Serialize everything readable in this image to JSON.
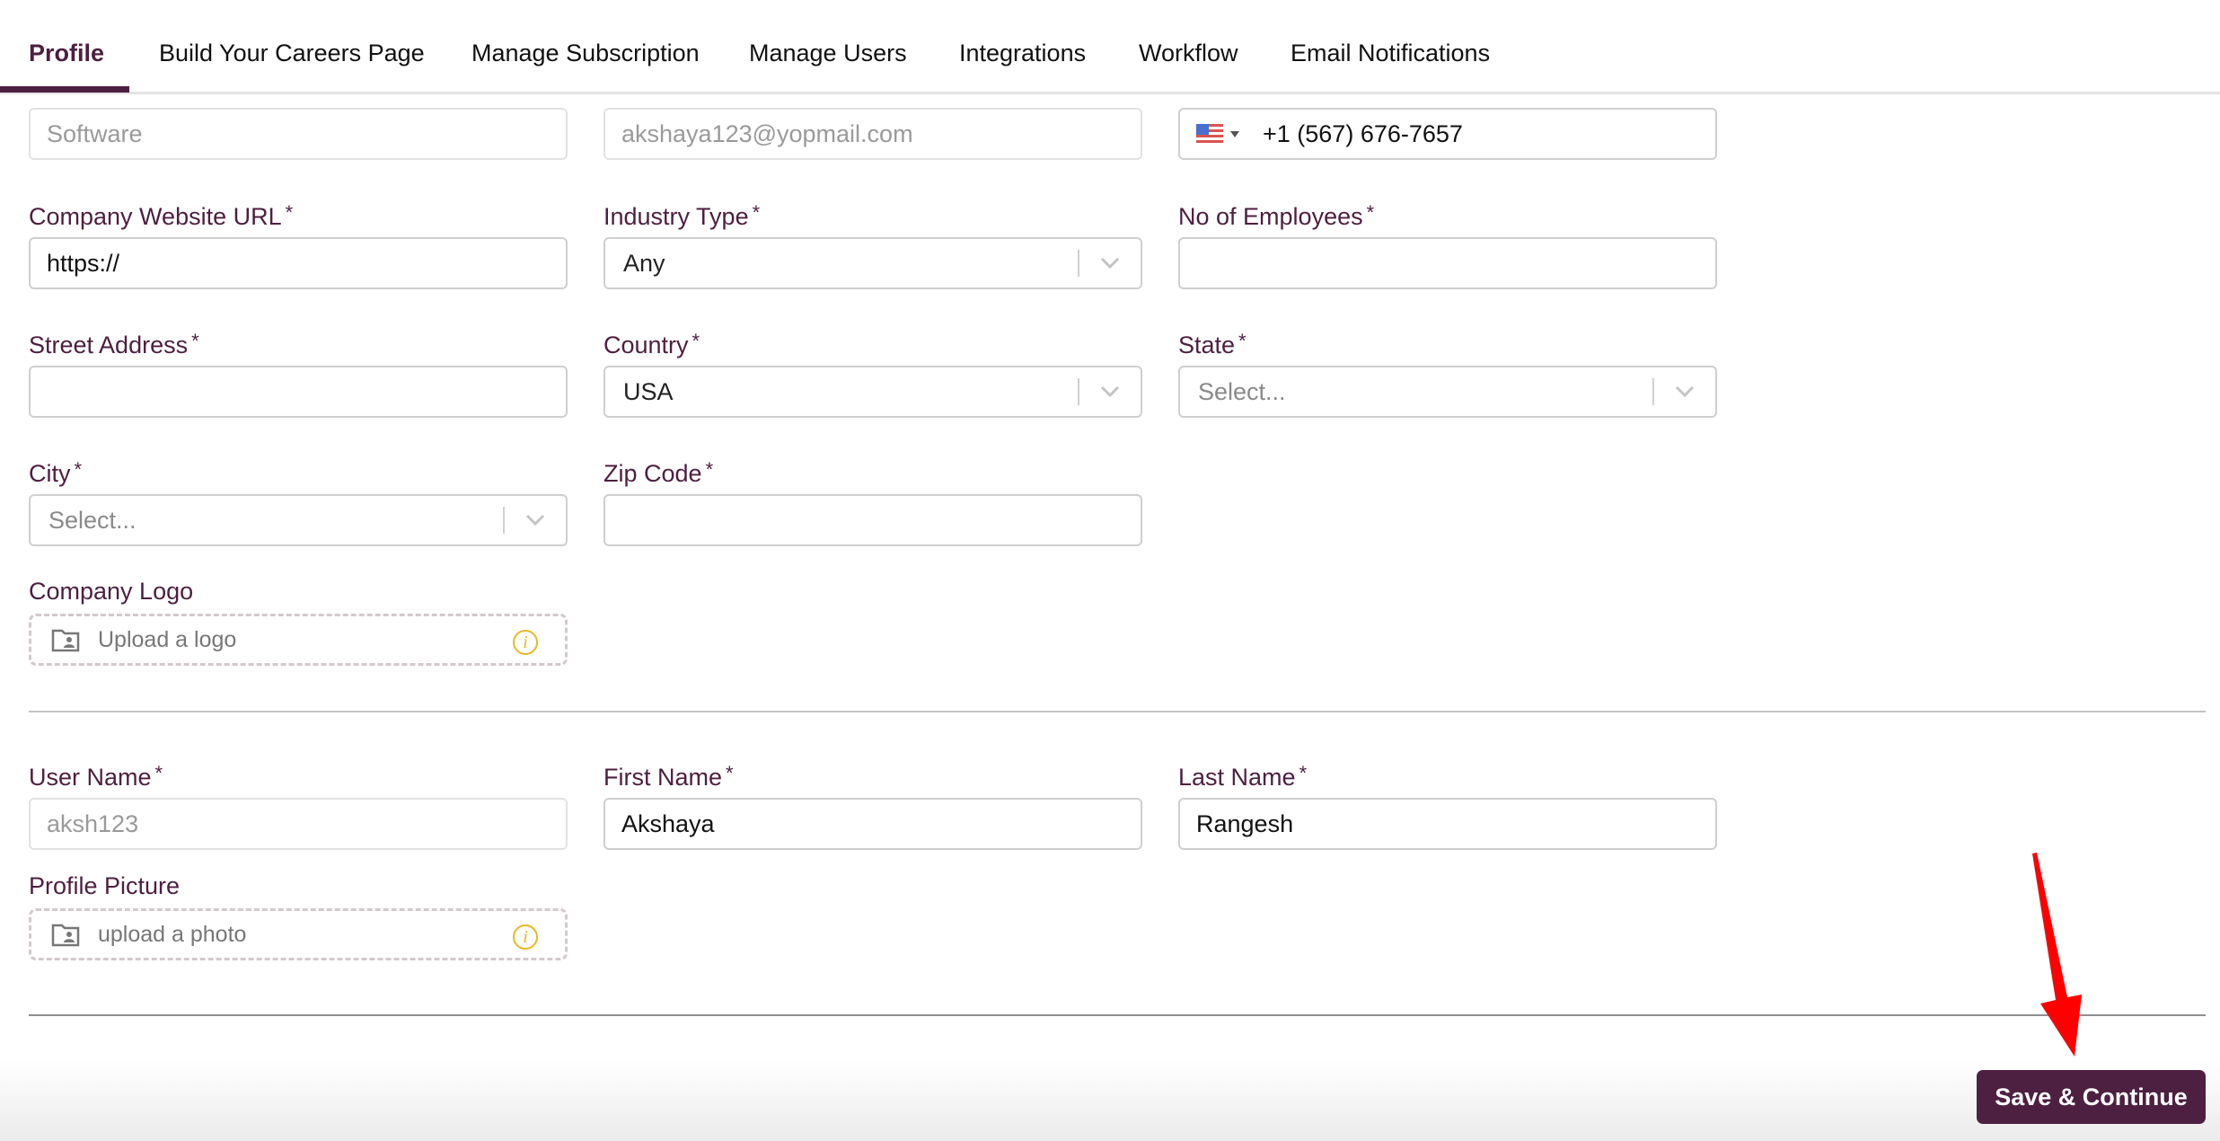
{
  "tabs": [
    {
      "label": "Profile",
      "active": true
    },
    {
      "label": "Build Your Careers Page",
      "active": false
    },
    {
      "label": "Manage Subscription",
      "active": false
    },
    {
      "label": "Manage Users",
      "active": false
    },
    {
      "label": "Integrations",
      "active": false
    },
    {
      "label": "Workflow",
      "active": false
    },
    {
      "label": "Email Notifications",
      "active": false
    }
  ],
  "company": {
    "company_name": {
      "value": "Software",
      "disabled": true
    },
    "email": {
      "value": "akshaya123@yopmail.com",
      "disabled": true
    },
    "phone": {
      "country_flag": "us-flag-icon",
      "value": "+1 (567) 676-7657"
    },
    "website_url": {
      "label": "Company Website URL",
      "required": "*",
      "value": "https://"
    },
    "industry_type": {
      "label": "Industry Type",
      "required": "*",
      "value": "Any"
    },
    "employees": {
      "label": "No of Employees",
      "required": "*",
      "value": ""
    },
    "street_address": {
      "label": "Street Address",
      "required": "*",
      "value": ""
    },
    "country": {
      "label": "Country",
      "required": "*",
      "value": "USA"
    },
    "state": {
      "label": "State",
      "required": "*",
      "placeholder": "Select..."
    },
    "city": {
      "label": "City",
      "required": "*",
      "placeholder": "Select..."
    },
    "zip_code": {
      "label": "Zip Code",
      "required": "*",
      "value": ""
    },
    "logo": {
      "label": "Company Logo",
      "upload_text": "Upload a logo"
    }
  },
  "user": {
    "user_name": {
      "label": "User Name",
      "required": "*",
      "value": "aksh123",
      "disabled": true
    },
    "first_name": {
      "label": "First Name",
      "required": "*",
      "value": "Akshaya"
    },
    "last_name": {
      "label": "Last Name",
      "required": "*",
      "value": "Rangesh"
    },
    "profile_picture": {
      "label": "Profile Picture",
      "upload_text": "upload a photo"
    }
  },
  "actions": {
    "save_label": "Save & Continue"
  },
  "colors": {
    "brand": "#4d1f40",
    "info_icon": "#e8b923",
    "annotation_arrow": "#ff0000"
  }
}
